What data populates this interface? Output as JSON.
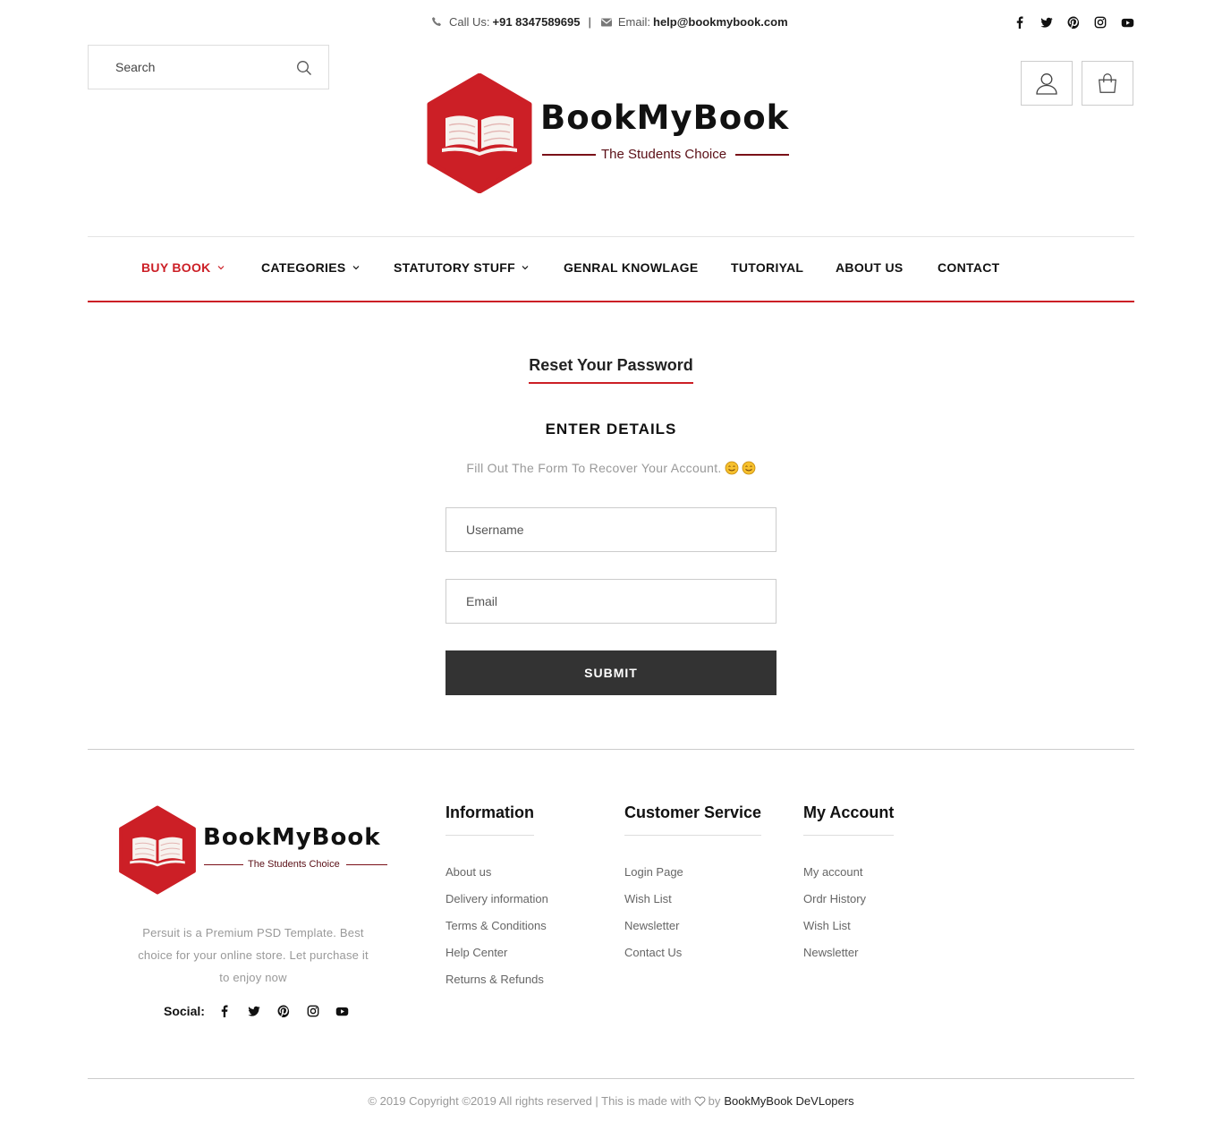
{
  "topbar": {
    "call_label": "Call Us:",
    "call_number": "+91 8347589695",
    "separator": "|",
    "email_label": "Email:",
    "email_value": "help@bookmybook.com",
    "socials": [
      "facebook-icon",
      "twitter-icon",
      "pinterest-icon",
      "instagram-icon",
      "youtube-icon"
    ]
  },
  "search": {
    "placeholder": "Search"
  },
  "header": {
    "logo_title": "BookMyBook",
    "logo_tagline": "The Students Choice",
    "brand_color": "#cc1f26"
  },
  "nav": {
    "items": [
      {
        "label": "BUY BOOK",
        "dropdown": true,
        "active": true
      },
      {
        "label": "CATEGORIES",
        "dropdown": true
      },
      {
        "label": "STATUTORY STUFF",
        "dropdown": true
      },
      {
        "label": "GENRAL KNOWLAGE",
        "dropdown": false
      },
      {
        "label": "TUTORIYAL",
        "dropdown": false
      },
      {
        "label": "ABOUT US",
        "dropdown": false
      },
      {
        "label": "CONTACT",
        "dropdown": false
      }
    ]
  },
  "main": {
    "title": "Reset Your Password",
    "heading": "ENTER DETAILS",
    "subtitle": "Fill Out The Form To Recover Your Account.",
    "username_placeholder": "Username",
    "email_placeholder": "Email",
    "submit_label": "SUBMIT"
  },
  "footer": {
    "logo_title": "BookMyBook",
    "logo_tagline": "The Students Choice",
    "description": "Persuit is a Premium PSD Template. Best choice for your online store. Let purchase it to enjoy now",
    "social_label": "Social:",
    "columns": [
      {
        "title": "Information",
        "links": [
          "About us",
          "Delivery information",
          "Terms & Conditions",
          "Help Center",
          "Returns & Refunds"
        ]
      },
      {
        "title": "Customer Service",
        "links": [
          "Login Page",
          "Wish List",
          "Newsletter",
          "Contact Us"
        ]
      },
      {
        "title": "My Account",
        "links": [
          "My account",
          "Ordr History",
          "Wish List",
          "Newsletter"
        ]
      }
    ],
    "copyright_text": "© 2019 Copyright ©2019 All rights reserved | This is made with",
    "copyright_by": "by",
    "copyright_brand": "BookMyBook DeVLopers"
  }
}
